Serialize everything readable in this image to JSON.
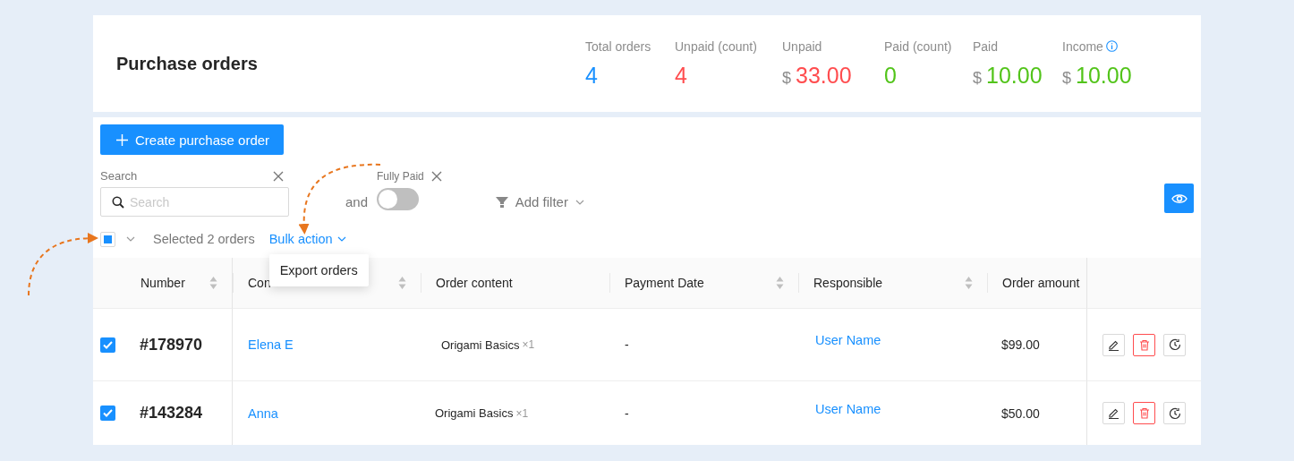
{
  "title": "Purchase orders",
  "stats": [
    {
      "label": "Total orders",
      "info": false,
      "value": "4",
      "color": "#1890ff"
    },
    {
      "label": "Unpaid (count)",
      "info": false,
      "value": "4",
      "color": "#ff4d4f"
    },
    {
      "label": "Unpaid",
      "info": false,
      "currency": "$",
      "value": "33.00",
      "color": "#ff4d4f"
    },
    {
      "label": "Paid (count)",
      "info": false,
      "value": "0",
      "color": "#52c41a"
    },
    {
      "label": "Paid",
      "info": false,
      "currency": "$",
      "value": "10.00",
      "color": "#52c41a"
    },
    {
      "label": "Income",
      "info": true,
      "currency": "$",
      "value": "10.00",
      "color": "#52c41a"
    }
  ],
  "create_button": "Create purchase order",
  "search": {
    "label": "Search",
    "placeholder": "Search"
  },
  "filter": {
    "connector": "and",
    "label": "Fully Paid",
    "on": false
  },
  "add_filter": "Add filter",
  "selection": {
    "partial": true,
    "text": "Selected 2 orders",
    "bulk_action": "Bulk action",
    "menu": [
      "Export orders"
    ]
  },
  "table": {
    "columns": [
      {
        "label": "Number",
        "sortable": true
      },
      {
        "label": "Con",
        "sortable": true
      },
      {
        "label": "Order content",
        "sortable": false
      },
      {
        "label": "Payment Date",
        "sortable": true
      },
      {
        "label": "Responsible",
        "sortable": true
      },
      {
        "label": "Order amount",
        "sortable": false
      }
    ],
    "rows": [
      {
        "selected": true,
        "number": "#178970",
        "contact": "Elena E",
        "item": "Origami Basics",
        "qty": "×1",
        "payment_date": "-",
        "responsible": "User Name",
        "amount": "$99.00"
      },
      {
        "selected": true,
        "number": "#143284",
        "contact": "Anna",
        "item": "Origami Basics",
        "qty": "×1",
        "payment_date": "-",
        "responsible": "User Name",
        "amount": "$50.00"
      }
    ]
  }
}
